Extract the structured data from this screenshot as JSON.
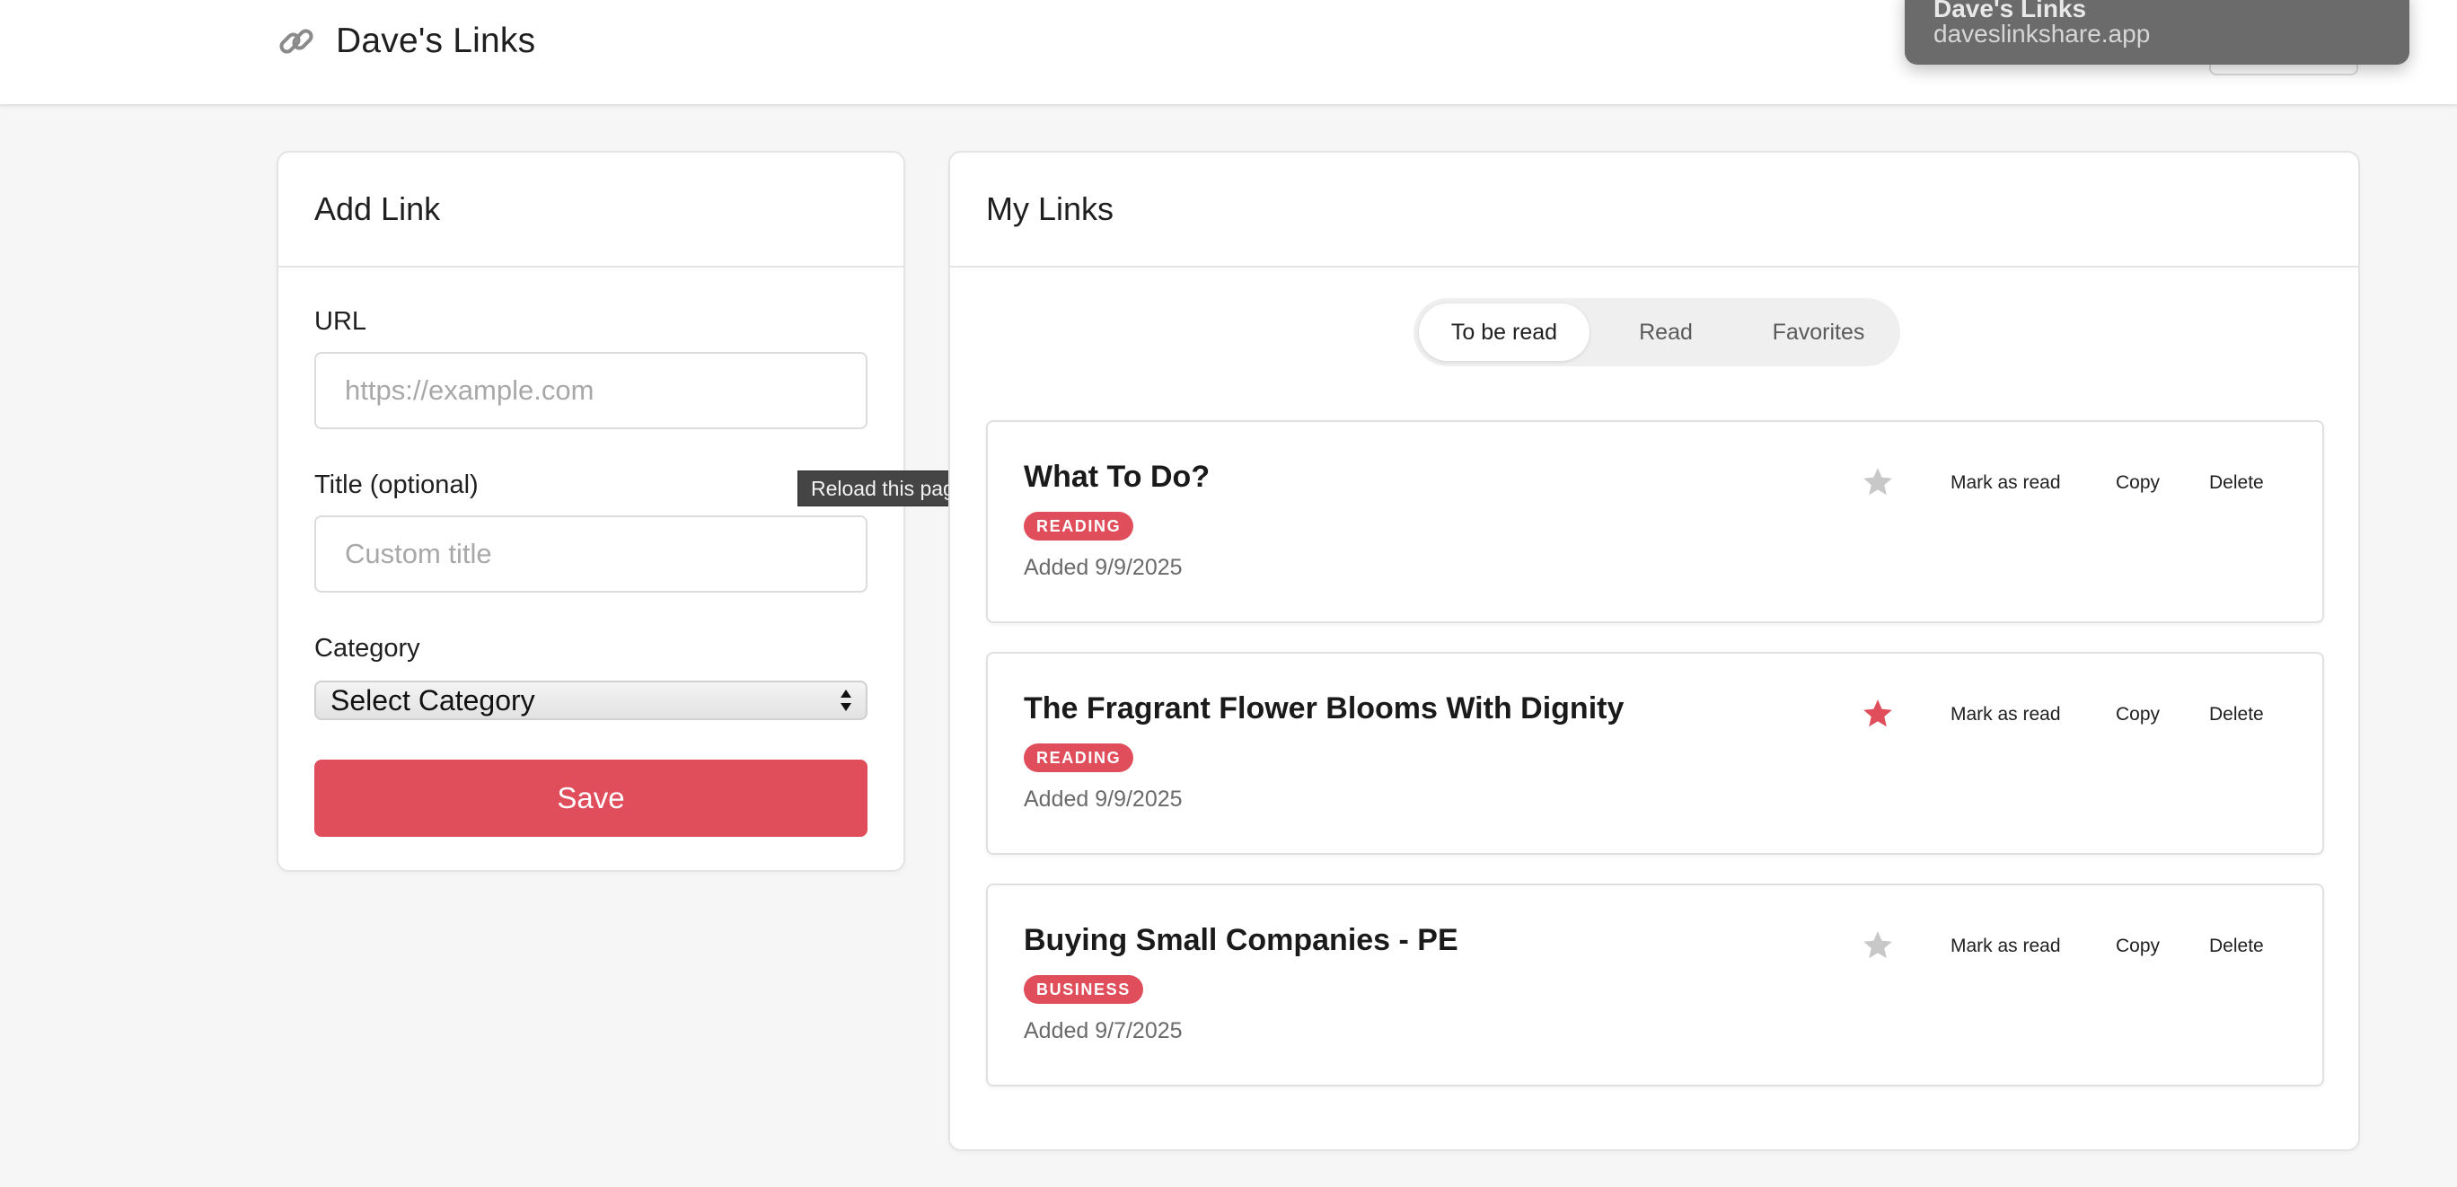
{
  "header": {
    "brand_icon": "link-icon",
    "title": "Dave's Links"
  },
  "popup": {
    "title": "Dave's Links",
    "subtitle": "daveslinkshare.app"
  },
  "tooltip": "Reload this page",
  "add_link": {
    "title": "Add Link",
    "url_label": "URL",
    "url_placeholder": "https://example.com",
    "url_value": "",
    "title_label": "Title (optional)",
    "title_placeholder": "Custom title",
    "title_value": "",
    "category_label": "Category",
    "category_selected": "Select Category",
    "save_label": "Save"
  },
  "my_links": {
    "title": "My Links",
    "tabs": [
      {
        "label": "To be read",
        "active": true
      },
      {
        "label": "Read",
        "active": false
      },
      {
        "label": "Favorites",
        "active": false
      }
    ],
    "actions": {
      "mark_read": "Mark as read",
      "copy": "Copy",
      "delete": "Delete"
    },
    "items": [
      {
        "title": "What To Do?",
        "category": "READING",
        "added": "Added 9/9/2025",
        "favorite": false
      },
      {
        "title": "The Fragrant Flower Blooms With Dignity",
        "category": "READING",
        "added": "Added 9/9/2025",
        "favorite": true
      },
      {
        "title": "Buying Small Companies - PE",
        "category": "BUSINESS",
        "added": "Added 9/7/2025",
        "favorite": false
      }
    ]
  },
  "colors": {
    "accent": "#e04e5c",
    "star_off": "#c8c8c8",
    "star_on": "#e04e5c"
  }
}
